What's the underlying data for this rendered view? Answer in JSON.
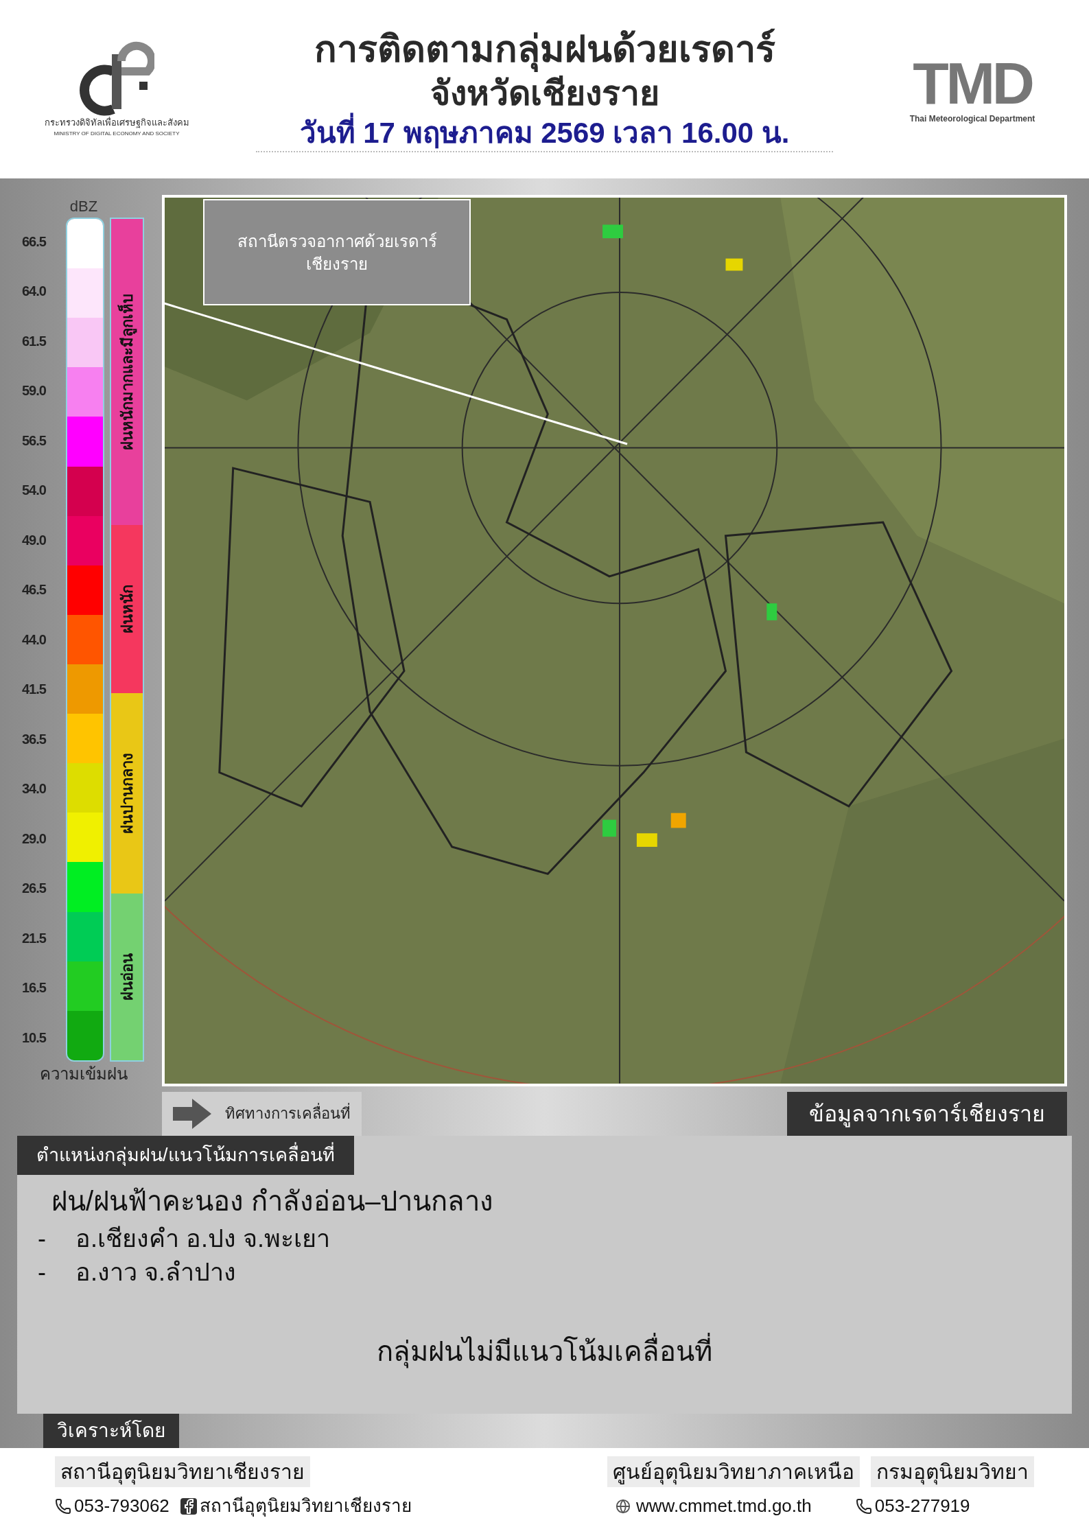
{
  "header": {
    "ministry_logo": {
      "name_th": "กระทรวงดิจิทัลเพื่อเศรษฐกิจและสังคม",
      "name_en": "MINISTRY OF DIGITAL ECONOMY AND SOCIETY"
    },
    "title": "การติดตามกลุ่มฝนด้วยเรดาร์",
    "subtitle": "จังหวัดเชียงราย",
    "date": "วันที่ 17 พฤษภาคม 2569 เวลา 16.00 น.",
    "tmd_logo": {
      "letters": "TMD",
      "name_en": "Thai Meteorological Department"
    }
  },
  "legend": {
    "unit": "dBZ",
    "caption": "ความเข้มฝน",
    "ticks": [
      "66.5",
      "64.0",
      "61.5",
      "59.0",
      "56.5",
      "54.0",
      "49.0",
      "46.5",
      "44.0",
      "41.5",
      "36.5",
      "34.0",
      "29.0",
      "26.5",
      "21.5",
      "16.5",
      "10.5"
    ],
    "segments": [
      {
        "color": "#ffffff"
      },
      {
        "color": "#fde6fb"
      },
      {
        "color": "#f9c7f5"
      },
      {
        "color": "#f780f0"
      },
      {
        "color": "#ff00ff"
      },
      {
        "color": "#d4004e"
      },
      {
        "color": "#ea0060"
      },
      {
        "color": "#ff0000"
      },
      {
        "color": "#ff5500"
      },
      {
        "color": "#ee9900"
      },
      {
        "color": "#ffc400"
      },
      {
        "color": "#dddd00"
      },
      {
        "color": "#f0f000"
      },
      {
        "color": "#00ee22"
      },
      {
        "color": "#00cc55"
      },
      {
        "color": "#22cc22"
      },
      {
        "color": "#11aa11"
      }
    ],
    "bands": [
      {
        "label": "ฝนหนักมากและมีลูกเห็บ",
        "color": "#e8409c"
      },
      {
        "label": "ฝนหนัก",
        "color": "#f5375e"
      },
      {
        "label": "ฝนปานกลาง",
        "color": "#e9c716"
      },
      {
        "label": "ฝนอ่อน",
        "color": "#74d171"
      }
    ]
  },
  "map": {
    "station_label": "สถานีตรวจอากาศด้วยเรดาร์เชียงราย"
  },
  "direction_legend": {
    "label": "ทิศทางการเคลื่อนที่"
  },
  "source": "ข้อมูลจากเรดาร์เชียงราย",
  "report": {
    "tab": "ตำแหน่งกลุ่มฝน/แนวโน้มการเคลื่อนที่",
    "heading": "ฝน/ฝนฟ้าคะนอง กำลังอ่อน–ปานกลาง",
    "items": [
      {
        "marker": "-",
        "text": "อ.เชียงคำ อ.ปง จ.พะเยา"
      },
      {
        "marker": "-",
        "text": "อ.งาว จ.ลำปาง"
      }
    ],
    "conclusion": "กลุ่มฝนไม่มีแนวโน้มเคลื่อนที่"
  },
  "footer": {
    "analyzed_by": "วิเคราะห์โดย",
    "station": "สถานีอุตุนิยมวิทยาเชียงราย",
    "station_phone": "053-793062",
    "facebook": "สถานีอุตุนิยมวิทยาเชียงราย",
    "center": "ศูนย์อุตุนิยมวิทยาภาคเหนือ",
    "department": "กรมอุตุนิยมวิทยา",
    "website": "www.cmmet.tmd.go.th",
    "department_phone": "053-277919"
  }
}
